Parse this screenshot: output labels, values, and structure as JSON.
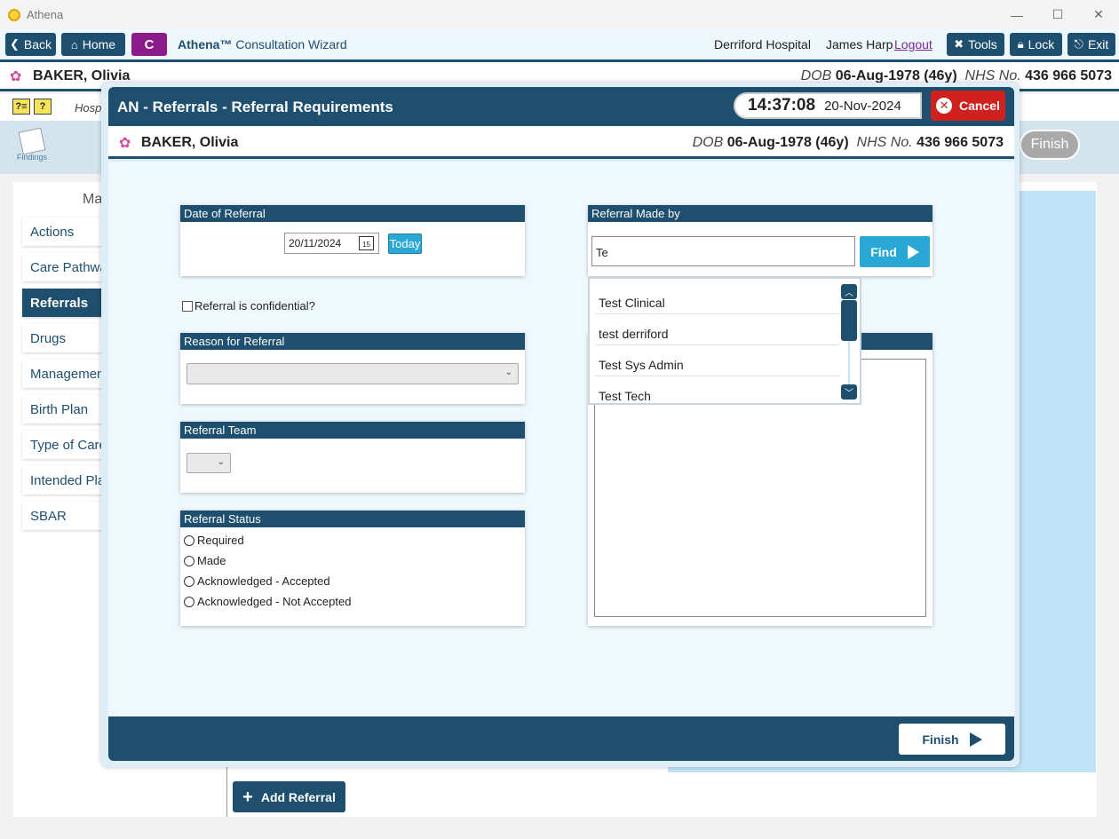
{
  "window": {
    "title": "Athena",
    "minimize": "—",
    "maximize": "☐",
    "close": "✕"
  },
  "toolbar": {
    "back": "Back",
    "home": "Home",
    "c_label": "C",
    "wizard_brand": "Athena™",
    "wizard_title": "Consultation Wizard",
    "hospital": "Derriford Hospital",
    "user": "James Harp",
    "logout": "Logout",
    "tools": "Tools",
    "lock": "Lock",
    "exit": "Exit"
  },
  "patient": {
    "name": "BAKER, Olivia",
    "dob_label": "DOB",
    "dob": "06-Aug-1978 (46y)",
    "nhs_label": "NHS No.",
    "nhs": "436 966 5073"
  },
  "subbar": {
    "hosp_label": "Hosp",
    "icon1": "?≡",
    "icon2": "?"
  },
  "background": {
    "findings_label": "Findings",
    "finish": "Finish",
    "mar_label": "Ma",
    "sidebar": [
      "Actions",
      "Care Pathwa",
      "Referrals",
      "Drugs",
      "Managemen",
      "Birth Plan",
      "Type of Care",
      "Intended Pla",
      "SBAR"
    ],
    "add_referral": "Add Referral"
  },
  "modal": {
    "title": "AN - Referrals - Referral Requirements",
    "time": "14:37:08",
    "date": "20-Nov-2024",
    "cancel": "Cancel",
    "finish": "Finish",
    "date_of_referral": {
      "header": "Date of Referral",
      "value": "20/11/2024",
      "cal_icon_text": "15",
      "today": "Today"
    },
    "confidential_label": "Referral is confidential?",
    "reason": {
      "header": "Reason for Referral"
    },
    "team": {
      "header": "Referral Team"
    },
    "status": {
      "header": "Referral Status",
      "options": [
        "Required",
        "Made",
        "Acknowledged - Accepted",
        "Acknowledged - Not Accepted"
      ]
    },
    "made_by": {
      "header": "Referral Made by",
      "search_value": "Te",
      "find": "Find",
      "results": [
        "Test Clinical",
        "test derriford",
        "Test Sys Admin",
        "Test Tech"
      ]
    }
  },
  "colors": {
    "brand_navy": "#1e4f6e",
    "accent_cyan": "#29a8d6",
    "cancel_red": "#d1211e",
    "c_purple": "#8b1a8a"
  }
}
